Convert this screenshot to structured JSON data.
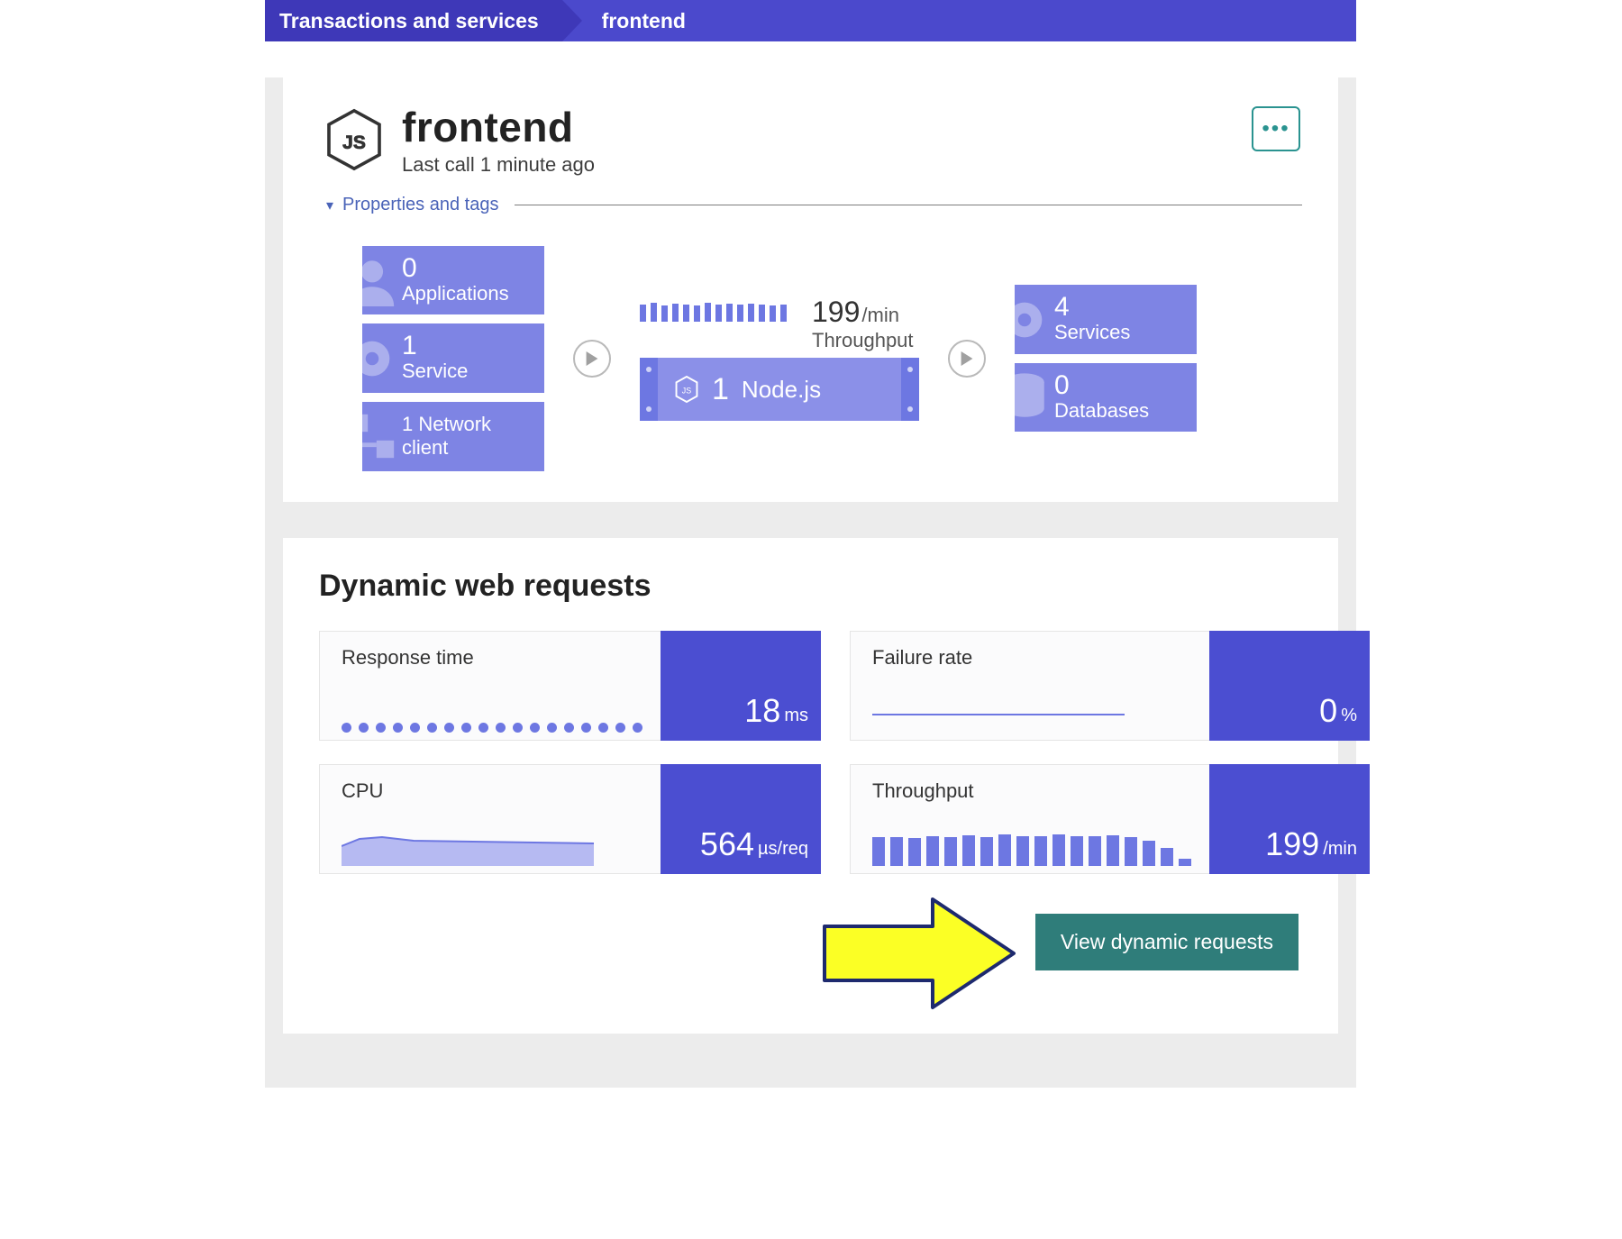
{
  "breadcrumb": {
    "root": "Transactions and services",
    "current": "frontend"
  },
  "header": {
    "title": "frontend",
    "subtitle": "Last call 1 minute ago",
    "props_toggle": "Properties and tags",
    "tech_icon": "nodejs-icon"
  },
  "flow": {
    "left": [
      {
        "n": "0",
        "label": "Applications",
        "icon": "person-icon"
      },
      {
        "n": "1",
        "label": "Service",
        "icon": "gear-icon"
      },
      {
        "n": "1",
        "label": "Network client",
        "icon": "network-icon"
      }
    ],
    "throughput": {
      "value": "199",
      "unit": "/min",
      "caption": "Throughput"
    },
    "server": {
      "count": "1",
      "tech": "Node.js"
    },
    "right": [
      {
        "n": "4",
        "label": "Services",
        "icon": "gear-icon"
      },
      {
        "n": "0",
        "label": "Databases",
        "icon": "db-icon"
      }
    ]
  },
  "requests": {
    "heading": "Dynamic web requests",
    "metrics": [
      {
        "title": "Response time",
        "value": "18",
        "unit": "ms",
        "viz": "dots"
      },
      {
        "title": "Failure rate",
        "value": "0",
        "unit": "%",
        "viz": "flat"
      },
      {
        "title": "CPU",
        "value": "564",
        "unit": "µs/req",
        "viz": "area"
      },
      {
        "title": "Throughput",
        "value": "199",
        "unit": "/min",
        "viz": "bars"
      }
    ],
    "button": "View dynamic requests"
  },
  "chart_data": [
    {
      "type": "line",
      "title": "Response time",
      "y_unit": "ms",
      "values": [
        18,
        18,
        18,
        18,
        18,
        18,
        18,
        18,
        18,
        18,
        18,
        18,
        18,
        18,
        18,
        18,
        18,
        18
      ]
    },
    {
      "type": "line",
      "title": "Failure rate",
      "y_unit": "%",
      "values": [
        0,
        0,
        0,
        0,
        0,
        0,
        0,
        0,
        0,
        0,
        0,
        0,
        0,
        0,
        0,
        0,
        0,
        0
      ]
    },
    {
      "type": "area",
      "title": "CPU",
      "y_unit": "µs/req",
      "values": [
        520,
        560,
        600,
        580,
        570,
        565,
        560,
        560,
        560,
        560,
        560,
        560,
        560,
        560,
        555,
        550,
        540,
        500
      ]
    },
    {
      "type": "bar",
      "title": "Throughput",
      "y_unit": "/min",
      "values": [
        190,
        195,
        190,
        200,
        195,
        205,
        195,
        210,
        200,
        200,
        210,
        200,
        200,
        205,
        195,
        170,
        120,
        40
      ]
    },
    {
      "type": "bar",
      "title": "Throughput sparkline",
      "y_unit": "/min",
      "values": [
        200,
        210,
        190,
        205,
        200,
        195,
        210,
        200,
        205,
        200,
        205,
        200,
        195,
        198
      ]
    }
  ]
}
